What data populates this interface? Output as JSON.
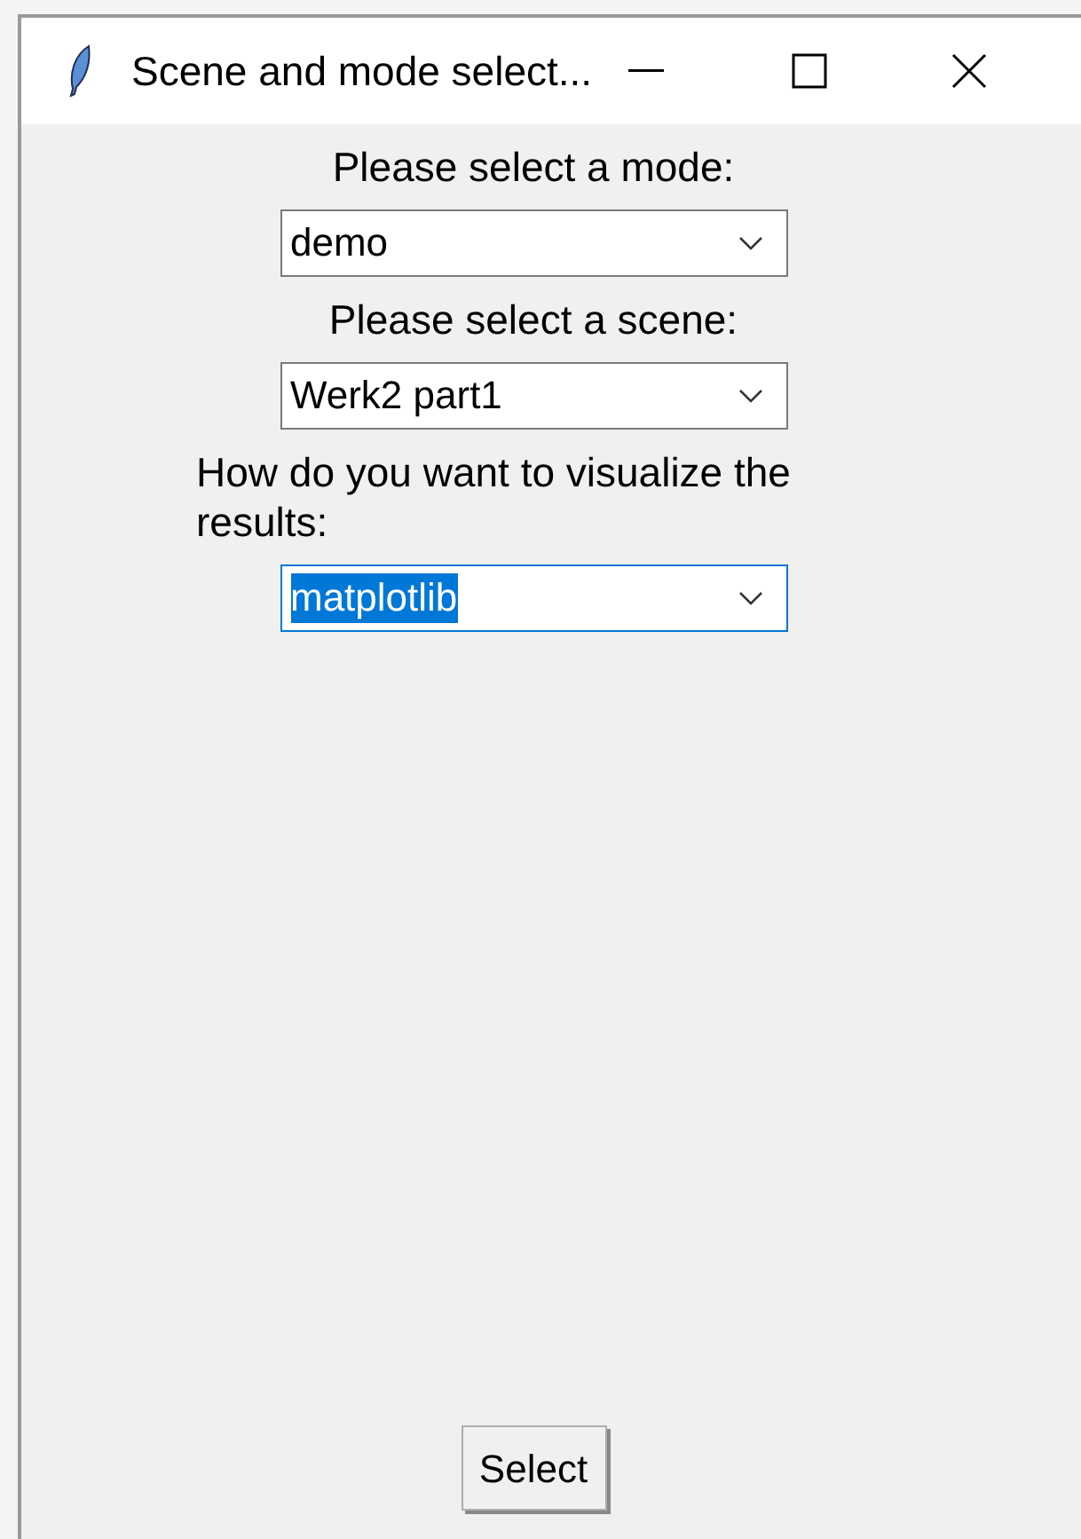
{
  "window": {
    "title": "Scene and mode select..."
  },
  "fields": [
    {
      "label": "Please select a mode:",
      "value": "demo",
      "focused": false
    },
    {
      "label": "Please select a scene:",
      "value": "Werk2 part1",
      "focused": false
    },
    {
      "label": "How do you want to visualize the results:",
      "value": "matplotlib",
      "focused": true
    }
  ],
  "button": "Select"
}
